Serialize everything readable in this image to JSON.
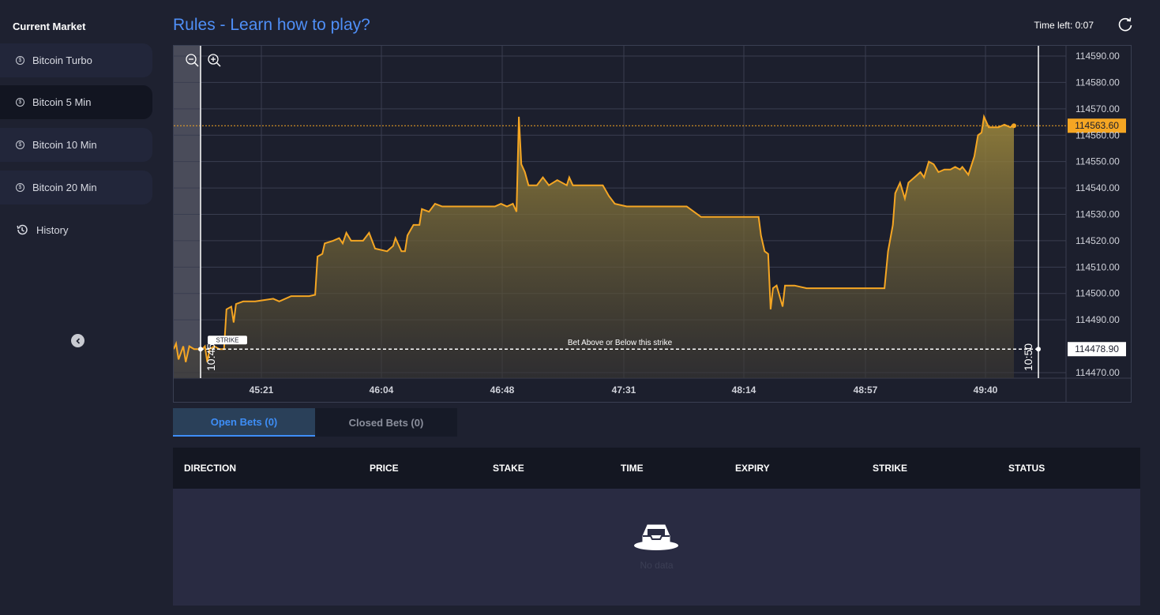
{
  "sidebar": {
    "title": "Current Market",
    "items": [
      {
        "label": "Bitcoin Turbo",
        "active": false
      },
      {
        "label": "Bitcoin 5 Min",
        "active": true
      },
      {
        "label": "Bitcoin 10 Min",
        "active": false
      },
      {
        "label": "Bitcoin 20 Min",
        "active": false
      }
    ],
    "history_label": "History"
  },
  "header": {
    "rules_link": "Rules - Learn how to play?",
    "time_left": "Time left: 0:07"
  },
  "chart_data": {
    "type": "area",
    "y_ticks": [
      "114590.00",
      "114580.00",
      "114570.00",
      "114560.00",
      "114550.00",
      "114540.00",
      "114530.00",
      "114520.00",
      "114510.00",
      "114500.00",
      "114490.00",
      "114470.00"
    ],
    "x_ticks": [
      "45:21",
      "46:04",
      "46:48",
      "47:31",
      "48:14",
      "48:57",
      "49:40"
    ],
    "ylim": [
      114467,
      114593
    ],
    "current_price": "114563.60",
    "strike_price": "114478.90",
    "strike_label": "STRIKE",
    "strike_caption": "Bet Above or Below this strike",
    "start_time": "10:45",
    "end_time": "10:50",
    "line_color": "#f5a623",
    "series": [
      {
        "values": [
          [
            44.62,
            114478.9
          ],
          [
            44.64,
            114481
          ],
          [
            44.66,
            114475
          ],
          [
            44.7,
            114480
          ],
          [
            44.72,
            114474
          ],
          [
            44.75,
            114480
          ],
          [
            44.79,
            114478.9
          ],
          [
            44.86,
            114478.9
          ],
          [
            44.88,
            114480
          ],
          [
            44.9,
            114474
          ],
          [
            44.92,
            114479
          ],
          [
            44.96,
            114480
          ],
          [
            45.0,
            114478.9
          ],
          [
            45.04,
            114478.9
          ],
          [
            45.06,
            114494
          ],
          [
            45.1,
            114495
          ],
          [
            45.12,
            114489
          ],
          [
            45.14,
            114496
          ],
          [
            45.2,
            114497
          ],
          [
            45.3,
            114497
          ],
          [
            45.45,
            114498
          ],
          [
            45.5,
            114497
          ],
          [
            45.6,
            114499
          ],
          [
            45.75,
            114499
          ],
          [
            45.8,
            114499.5
          ],
          [
            45.82,
            114514
          ],
          [
            45.86,
            114515
          ],
          [
            45.88,
            114519
          ],
          [
            45.95,
            114520
          ],
          [
            46.0,
            114521
          ],
          [
            46.03,
            114519
          ],
          [
            46.06,
            114523
          ],
          [
            46.1,
            114520
          ],
          [
            46.2,
            114520
          ],
          [
            46.25,
            114523
          ],
          [
            46.3,
            114517
          ],
          [
            46.4,
            114516
          ],
          [
            46.45,
            114518
          ],
          [
            46.47,
            114521
          ],
          [
            46.52,
            114516
          ],
          [
            46.55,
            114516
          ],
          [
            46.57,
            114522
          ],
          [
            46.62,
            114526
          ],
          [
            46.67,
            114526
          ],
          [
            46.69,
            114532
          ],
          [
            46.75,
            114531
          ],
          [
            46.8,
            114534
          ],
          [
            46.86,
            114533
          ],
          [
            46.95,
            114533
          ],
          [
            47.1,
            114533
          ],
          [
            47.3,
            114533
          ],
          [
            47.35,
            114534
          ],
          [
            47.4,
            114533
          ],
          [
            47.45,
            114534
          ],
          [
            47.48,
            114531
          ],
          [
            47.5,
            114567
          ],
          [
            47.52,
            114549
          ],
          [
            47.55,
            114546
          ],
          [
            47.58,
            114541
          ],
          [
            47.65,
            114541
          ],
          [
            47.7,
            114544
          ],
          [
            47.75,
            114541
          ],
          [
            47.82,
            114543
          ],
          [
            47.9,
            114541
          ],
          [
            47.92,
            114544
          ],
          [
            47.95,
            114541
          ],
          [
            48.05,
            114541
          ],
          [
            48.2,
            114541
          ],
          [
            48.25,
            114537
          ],
          [
            48.3,
            114534
          ],
          [
            48.4,
            114533
          ],
          [
            48.6,
            114533
          ],
          [
            48.8,
            114533
          ],
          [
            48.9,
            114533
          ],
          [
            49.02,
            114529
          ],
          [
            49.2,
            114529
          ],
          [
            49.4,
            114529
          ],
          [
            49.5,
            114529
          ],
          [
            49.52,
            114522
          ],
          [
            49.55,
            114516
          ],
          [
            49.58,
            114515
          ],
          [
            49.6,
            114494
          ],
          [
            49.62,
            114502
          ],
          [
            49.65,
            114503
          ],
          [
            49.7,
            114495
          ],
          [
            49.72,
            114503
          ],
          [
            49.8,
            114503
          ],
          [
            49.9,
            114502
          ],
          [
            50.05,
            114502
          ],
          [
            50.25,
            114502
          ],
          [
            50.45,
            114502
          ],
          [
            50.55,
            114502
          ],
          [
            50.58,
            114516
          ],
          [
            50.62,
            114526
          ],
          [
            50.64,
            114538
          ],
          [
            50.68,
            114542
          ],
          [
            50.72,
            114536
          ],
          [
            50.75,
            114542
          ],
          [
            50.8,
            114544
          ],
          [
            50.85,
            114546
          ],
          [
            50.88,
            114544
          ],
          [
            50.92,
            114550
          ],
          [
            50.96,
            114549
          ],
          [
            51.0,
            114546
          ],
          [
            51.05,
            114547
          ],
          [
            51.1,
            114547
          ],
          [
            51.14,
            114548
          ],
          [
            51.18,
            114547
          ],
          [
            51.2,
            114548
          ],
          [
            51.25,
            114545
          ],
          [
            51.3,
            114552
          ],
          [
            51.33,
            114560
          ],
          [
            51.36,
            114561
          ],
          [
            51.38,
            114567
          ],
          [
            51.42,
            114563
          ],
          [
            51.5,
            114563
          ],
          [
            51.55,
            114564
          ],
          [
            51.6,
            114563
          ],
          [
            51.63,
            114563.6
          ]
        ]
      }
    ]
  },
  "tabs": [
    {
      "label": "Open Bets (0)",
      "active": true
    },
    {
      "label": "Closed Bets (0)",
      "active": false
    }
  ],
  "table": {
    "columns": [
      "DIRECTION",
      "PRICE",
      "STAKE",
      "TIME",
      "EXPIRY",
      "STRIKE",
      "STATUS"
    ],
    "empty_text": "No data"
  }
}
